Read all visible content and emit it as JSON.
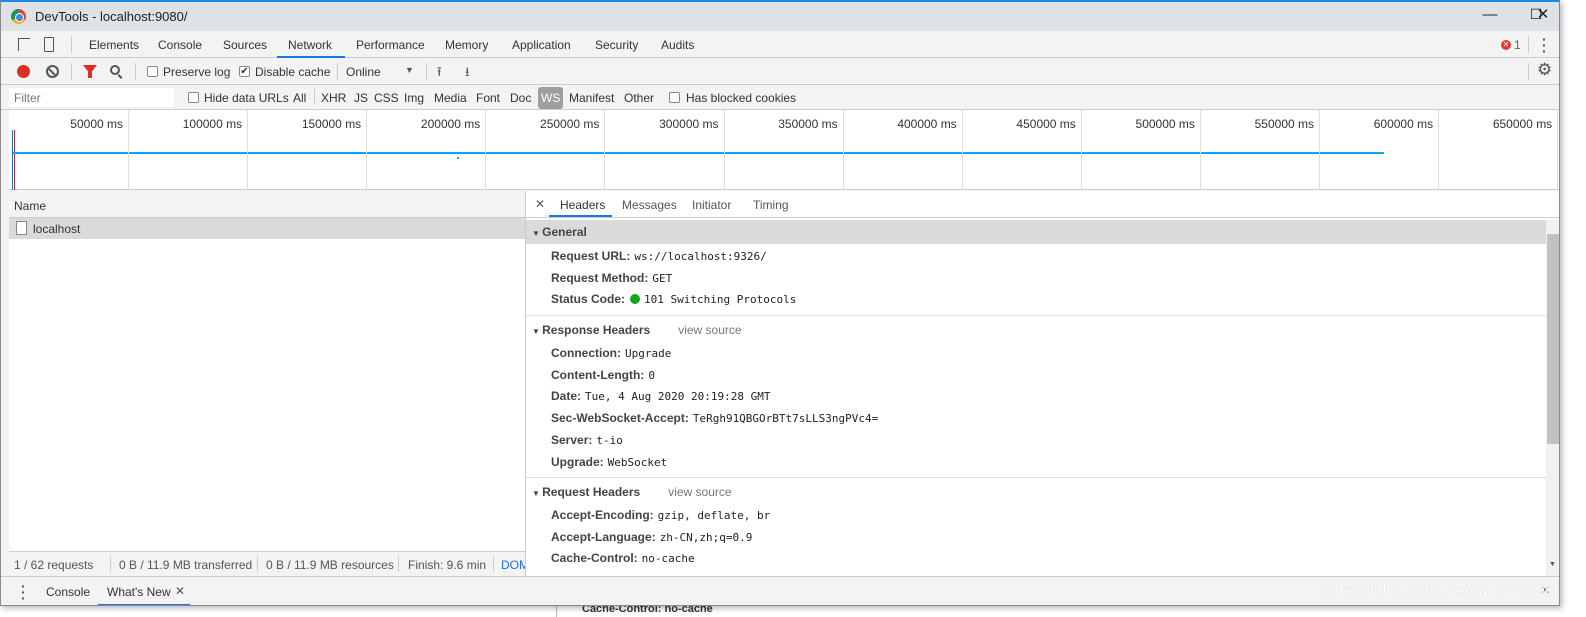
{
  "window": {
    "title": "DevTools - localhost:9080/",
    "minimize": "—",
    "maximize": "☐",
    "close": "✕"
  },
  "tabs": [
    {
      "label": "Elements"
    },
    {
      "label": "Console"
    },
    {
      "label": "Sources"
    },
    {
      "label": "Network",
      "active": true
    },
    {
      "label": "Performance"
    },
    {
      "label": "Memory"
    },
    {
      "label": "Application"
    },
    {
      "label": "Security"
    },
    {
      "label": "Audits"
    }
  ],
  "error_count": "1",
  "toolbar": {
    "preserve_log": "Preserve log",
    "preserve_log_checked": false,
    "disable_cache": "Disable cache",
    "disable_cache_checked": true,
    "throttling": "Online"
  },
  "filter": {
    "placeholder": "Filter",
    "hide_data_urls": "Hide data URLs",
    "types": [
      "All",
      "XHR",
      "JS",
      "CSS",
      "Img",
      "Media",
      "Font",
      "Doc",
      "WS",
      "Manifest",
      "Other"
    ],
    "selected": "WS",
    "has_blocked_cookies": "Has blocked cookies"
  },
  "timeline": {
    "ticks": [
      "50000 ms",
      "100000 ms",
      "150000 ms",
      "200000 ms",
      "250000 ms",
      "300000 ms",
      "350000 ms",
      "400000 ms",
      "450000 ms",
      "500000 ms",
      "550000 ms",
      "600000 ms",
      "650000 ms"
    ]
  },
  "list": {
    "header": "Name",
    "rows": [
      {
        "name": "localhost"
      }
    ]
  },
  "details": {
    "tabs": [
      "Headers",
      "Messages",
      "Initiator",
      "Timing"
    ],
    "active_tab": "Headers",
    "general": {
      "title": "General",
      "items": [
        {
          "k": "Request URL:",
          "v": "ws://localhost:9326/"
        },
        {
          "k": "Request Method:",
          "v": "GET"
        },
        {
          "k": "Status Code:",
          "v": "101 Switching Protocols"
        }
      ]
    },
    "response": {
      "title": "Response Headers",
      "view_source": "view source",
      "items": [
        {
          "k": "Connection:",
          "v": "Upgrade"
        },
        {
          "k": "Content-Length:",
          "v": "0"
        },
        {
          "k": "Date:",
          "v": "Tue, 4 Aug 2020 20:19:28 GMT"
        },
        {
          "k": "Sec-WebSocket-Accept:",
          "v": "TeRgh91QBGOrBTt7sLLS3ngPVc4="
        },
        {
          "k": "Server:",
          "v": "t-io"
        },
        {
          "k": "Upgrade:",
          "v": "WebSocket"
        }
      ]
    },
    "request": {
      "title": "Request Headers",
      "view_source": "view source",
      "items": [
        {
          "k": "Accept-Encoding:",
          "v": "gzip, deflate, br"
        },
        {
          "k": "Accept-Language:",
          "v": "zh-CN,zh;q=0.9"
        },
        {
          "k": "Cache-Control:",
          "v": "no-cache"
        }
      ]
    }
  },
  "status": {
    "requests": "1 / 62 requests",
    "transferred": "0 B / 11.9 MB transferred",
    "resources": "0 B / 11.9 MB resources",
    "finish": "Finish: 9.6 min",
    "dom": "DOM"
  },
  "drawer": {
    "tabs": [
      "Console",
      "What's New"
    ],
    "close": "✕"
  },
  "overflow": "Cache-Control: no-cache",
  "watermark": "https://blog.csdn.net/mm44529654",
  "colors": {
    "accent": "#1a73e8",
    "record": "#d93025",
    "filter_active": "#d93025",
    "status_ok": "#0f9d58",
    "timeline_line": "#03a9f4"
  }
}
